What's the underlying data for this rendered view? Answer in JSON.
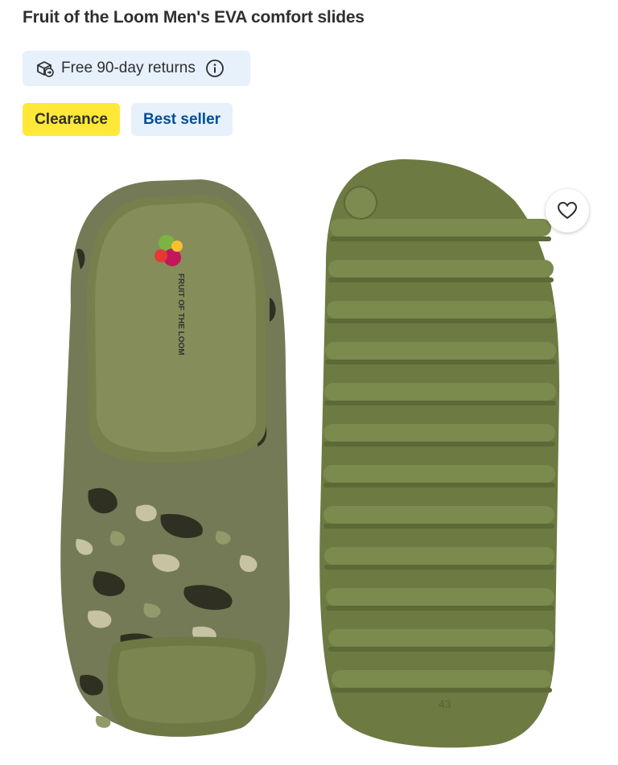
{
  "product": {
    "title": "Fruit of the Loom Men's EVA comfort slides"
  },
  "returns": {
    "label": "Free 90-day returns",
    "icon": "box-return-icon",
    "info_icon": "info-icon"
  },
  "badges": {
    "clearance": "Clearance",
    "best_seller": "Best seller"
  },
  "image": {
    "brand_mark": "FRUIT OF THE LOOM",
    "size_mark": "43"
  },
  "colors": {
    "accent_blue": "#004f9a",
    "clearance_yellow": "#ffe838",
    "badge_bg": "#e6f1fc",
    "slide_olive": "#6d7a42"
  }
}
